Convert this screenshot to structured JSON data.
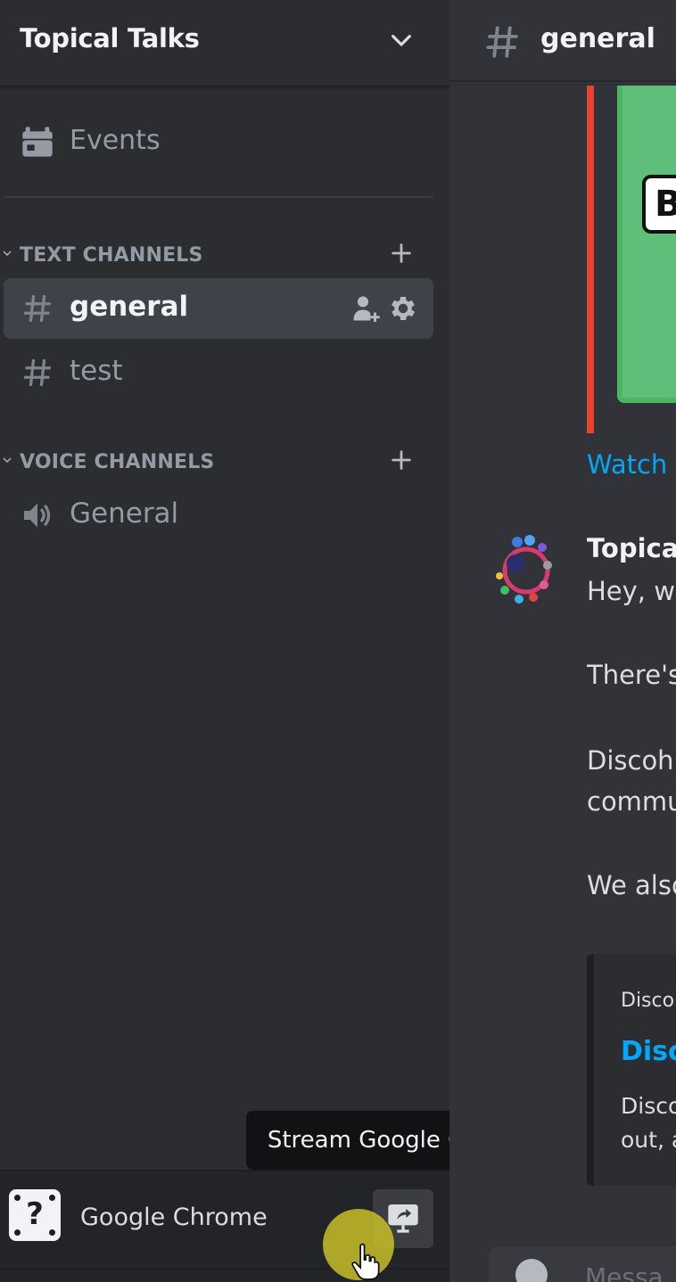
{
  "server": {
    "name": "Topical Talks"
  },
  "events": {
    "label": "Events"
  },
  "categories": {
    "text": {
      "label": "TEXT CHANNELS"
    },
    "voice": {
      "label": "VOICE CHANNELS"
    }
  },
  "channels": {
    "text": [
      {
        "name": "general",
        "selected": true
      },
      {
        "name": "test",
        "selected": false
      }
    ],
    "voice": [
      {
        "name": "General"
      }
    ]
  },
  "activity": {
    "game_name": "Google Chrome",
    "stream_tooltip": "Stream Google Chrome"
  },
  "main": {
    "channel_title": "general",
    "embed_link": "Watch",
    "thumbnail_letter": "B",
    "message": {
      "author": "Topical",
      "lines": [
        "Hey, we",
        "There's",
        "Discoh",
        "commu",
        "We also"
      ]
    },
    "embed": {
      "provider": "Discor",
      "title": "Disc",
      "desc_lines": [
        "Disco",
        "out, a"
      ]
    },
    "composer_placeholder": "Messa"
  },
  "colors": {
    "sidebar_bg": "#2b2d31",
    "main_bg": "#313338",
    "selected_channel_bg": "#404249",
    "link": "#00a8fc",
    "embed_accent": "#e8432e",
    "cursor_highlight": "#c8be28"
  }
}
